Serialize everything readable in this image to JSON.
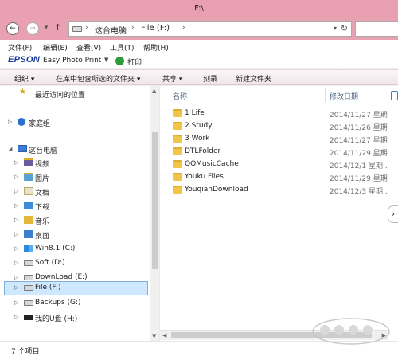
{
  "window": {
    "title": "F:\\"
  },
  "nav": {
    "back_icon": "arrow-left-icon",
    "forward_icon": "arrow-right-icon",
    "breadcrumb": [
      "这台电脑",
      "File (F:)"
    ]
  },
  "menu": [
    "文件(F)",
    "编辑(E)",
    "查看(V)",
    "工具(T)",
    "帮助(H)"
  ],
  "epson": {
    "logo": "EPSON",
    "app": "Easy Photo Print",
    "print": "打印"
  },
  "commands": [
    "组织",
    "在库中包含所选的文件夹",
    "共享",
    "刻录",
    "新建文件夹"
  ],
  "tree": {
    "recent": "最近访问的位置",
    "homegroup": "家庭组",
    "this_pc": "这台电脑",
    "items": [
      {
        "label": "视频",
        "icon": "video-folder-icon"
      },
      {
        "label": "图片",
        "icon": "pictures-folder-icon"
      },
      {
        "label": "文档",
        "icon": "documents-folder-icon"
      },
      {
        "label": "下载",
        "icon": "downloads-folder-icon"
      },
      {
        "label": "音乐",
        "icon": "music-folder-icon"
      },
      {
        "label": "桌面",
        "icon": "desktop-folder-icon"
      },
      {
        "label": "Win8.1 (C:)",
        "icon": "windows-drive-icon"
      },
      {
        "label": "Soft (D:)",
        "icon": "drive-icon"
      },
      {
        "label": "DownLoad (E:)",
        "icon": "drive-icon"
      },
      {
        "label": "File (F:)",
        "icon": "drive-icon"
      },
      {
        "label": "Backups (G:)",
        "icon": "drive-icon"
      },
      {
        "label": "我的U盘 (H:)",
        "icon": "usb-drive-icon"
      }
    ],
    "selected": "File (F:)"
  },
  "files": {
    "columns": {
      "name": "名称",
      "date": "修改日期"
    },
    "rows": [
      {
        "name": "1 Life",
        "date": "2014/11/27 星期..."
      },
      {
        "name": "2 Study",
        "date": "2014/11/26 星期..."
      },
      {
        "name": "3 Work",
        "date": "2014/11/27 星期..."
      },
      {
        "name": "DTLFolder",
        "date": "2014/11/29 星期..."
      },
      {
        "name": "QQMusicCache",
        "date": "2014/12/1 星期..."
      },
      {
        "name": "Youku Files",
        "date": "2014/11/29 星期..."
      },
      {
        "name": "YouqianDownload",
        "date": "2014/12/3 星期..."
      }
    ]
  },
  "status": {
    "count": "7 个项目"
  },
  "colors": {
    "titlebar": "#e8a0b0",
    "selection": "#cde8ff",
    "folder": "#f0c64a"
  }
}
